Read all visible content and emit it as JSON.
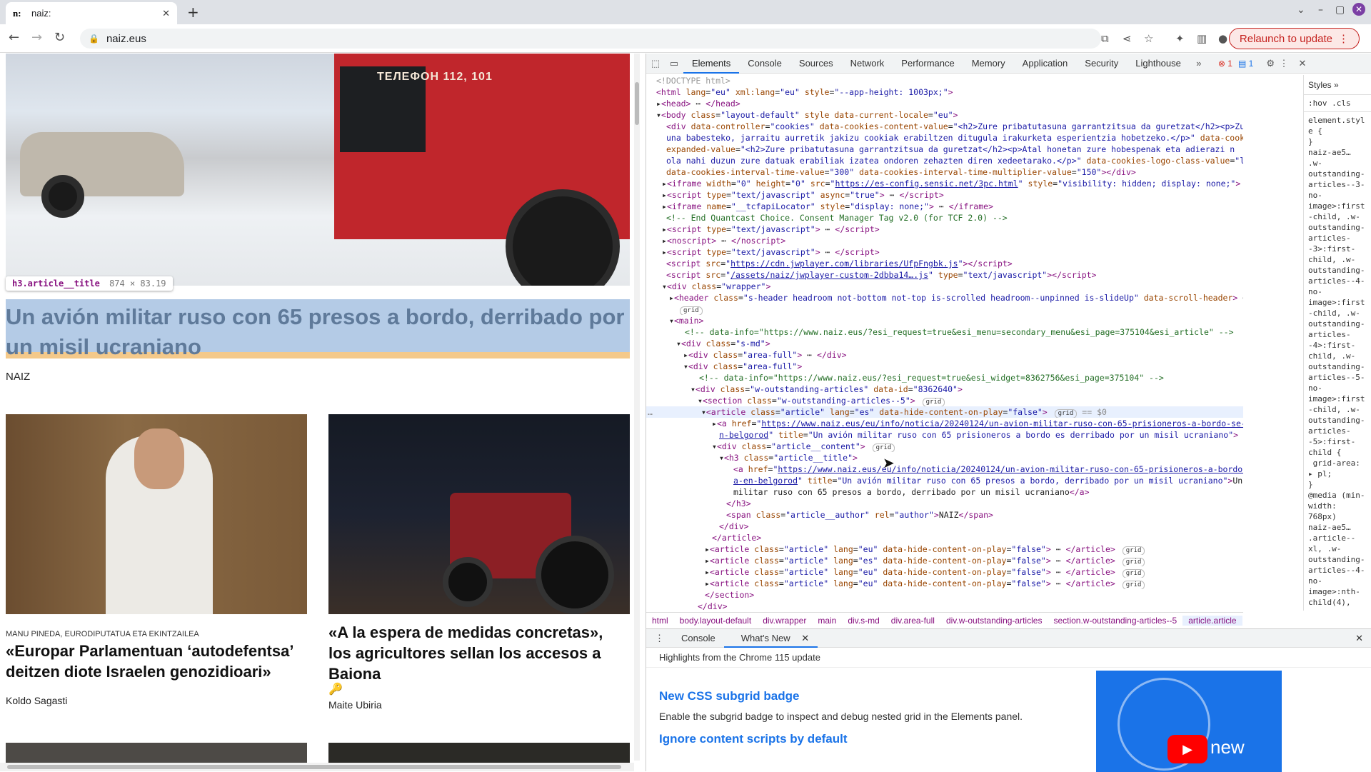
{
  "browser": {
    "tab_title": "naiz:",
    "tab_favicon": "n:",
    "url": "naiz.eus",
    "relaunch_label": "Relaunch to update"
  },
  "page": {
    "hero_truck_text": "ТЕЛЕФОН 112, 101",
    "tooltip_selector": "h3.article__title",
    "tooltip_size": "874 × 83.19",
    "main_title": "Un avión militar ruso con 65 presos a bordo, derribado por un misil ucraniano",
    "main_author": "NAIZ",
    "article2_kicker": "MANU PINEDA, EURODIPUTATUA ETA EKINTZAILEA",
    "article2_title": "«Europar Parlamentuan ‘autodefentsa’ deitzen diote Israelen genozidioari»",
    "article2_author": "Koldo Sagasti",
    "article3_title": "«A la espera de medidas concretas», los agricultores sellan los accesos a Baiona",
    "article3_author": "Maite Ubiria"
  },
  "devtools": {
    "tabs": [
      "Elements",
      "Console",
      "Sources",
      "Network",
      "Performance",
      "Memory",
      "Application",
      "Security",
      "Lighthouse"
    ],
    "active_tab": "Elements",
    "error_count": "1",
    "message_count": "1",
    "styles_tabs": [
      "Styles"
    ],
    "styles_filter": ":hov .cls",
    "styles_text": "element.style {\n}\nnaiz-ae5…\n.w-outstanding-articles--3-no-image>:first-child, .w-outstanding-articles--3>:first-child, .w-outstanding-articles--4-no-image>:first-child, .w-outstanding-articles--4>:first-child, .w-outstanding-articles--5-no-image>:first-child, .w-outstanding-articles--5>:first-child {\n grid-area: ▸ pl;\n}\n@media (min-width: 768px)\nnaiz-ae5…\n.article--xl, .w-outstanding-articles--4-no-image>:nth-child(4), .w-outstanding-articles-",
    "breadcrumbs": [
      "html",
      "body.layout-default",
      "div.wrapper",
      "main",
      "div.s-md",
      "div.area-full",
      "div.w-outstanding-articles",
      "section.w-outstanding-articles--5",
      "article.article"
    ],
    "drawer_tabs": [
      "Console",
      "What's New"
    ],
    "drawer_header": "Highlights from the Chrome 115 update",
    "whatsnew": [
      {
        "title": "New CSS subgrid badge",
        "desc": "Enable the subgrid badge to inspect and debug nested grid in the Elements panel."
      },
      {
        "title": "Ignore content scripts by default",
        "desc": ""
      }
    ],
    "whatsnew_image_text": "new"
  }
}
